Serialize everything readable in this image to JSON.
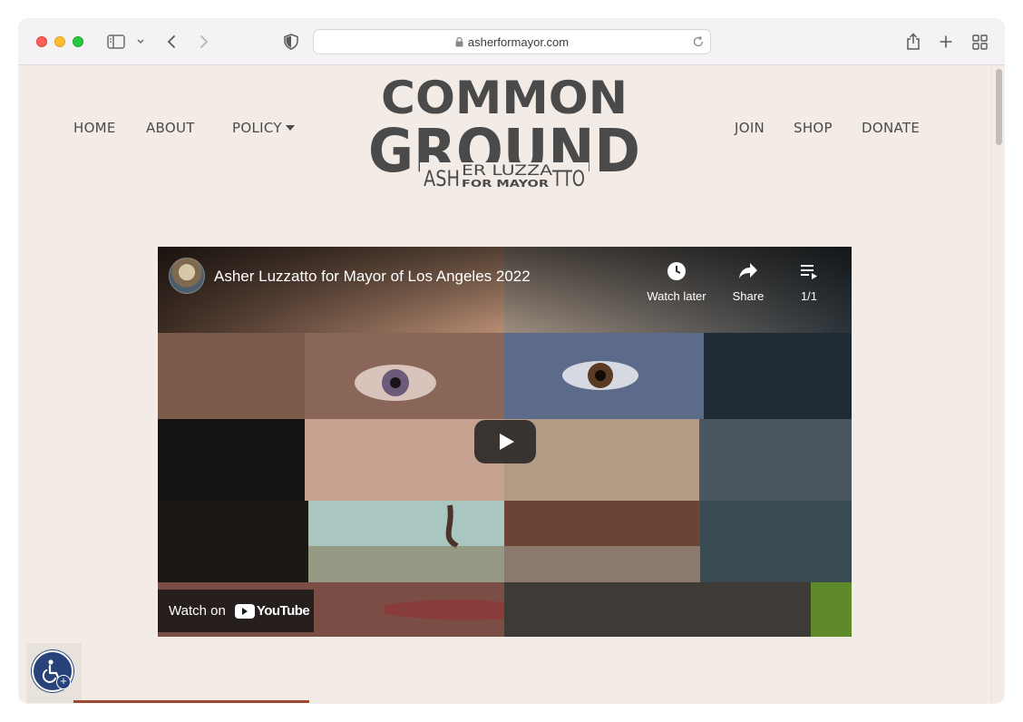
{
  "browser": {
    "url": "asherformayor.com"
  },
  "nav": {
    "left": [
      "HOME",
      "ABOUT",
      "POLICY"
    ],
    "right": [
      "JOIN",
      "SHOP",
      "DONATE"
    ]
  },
  "logo": {
    "line1": "COMMON",
    "line2": "GROUND",
    "line3a": "ASH",
    "line3b": "ER LUZZA",
    "line3c": "TTO",
    "line4": "FOR MAYOR"
  },
  "video": {
    "title": "Asher Luzzatto for Mayor of Los Angeles 2022",
    "watch_later": "Watch later",
    "share": "Share",
    "playlist_count": "1/1",
    "watch_on": "Watch on",
    "youtube": "YouTube"
  },
  "colors": {
    "page_bg": "#f3ece6",
    "nav_text": "#4a4a4a",
    "logo": "#4a4a4a",
    "accent": "#9a4a2e",
    "a11y": "#27437a"
  },
  "icons": [
    "sidebar-icon",
    "chevron-down-icon",
    "back-icon",
    "forward-icon",
    "shield-icon",
    "lock-icon",
    "reload-icon",
    "share-icon",
    "plus-icon",
    "tabs-grid-icon",
    "clock-icon",
    "share-arrow-icon",
    "playlist-icon",
    "play-icon",
    "youtube-logo-icon",
    "accessibility-icon"
  ]
}
